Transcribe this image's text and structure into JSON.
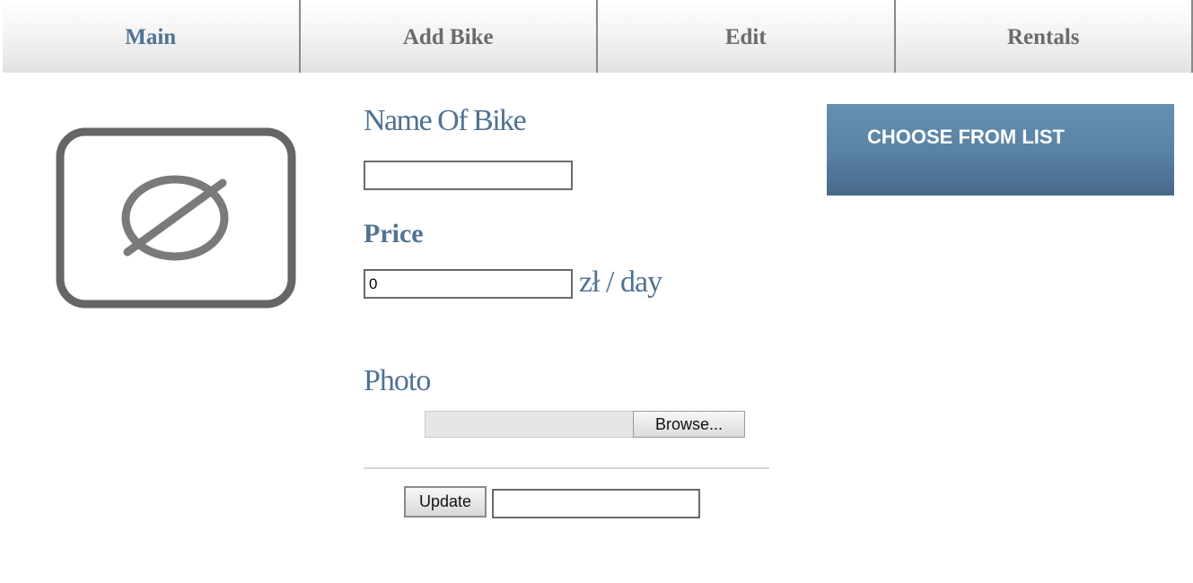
{
  "nav": {
    "tabs": [
      {
        "label": "Main",
        "active": true
      },
      {
        "label": "Add Bike",
        "active": false
      },
      {
        "label": "Edit",
        "active": false
      },
      {
        "label": "Rentals",
        "active": false
      }
    ]
  },
  "image": {
    "icon": "no-image-icon"
  },
  "form": {
    "name_label": "Name Of Bike",
    "name_value": "",
    "price_label": "Price",
    "price_value": "0",
    "price_unit": "zł / day",
    "photo_label": "Photo",
    "browse_label": "Browse...",
    "update_label": "Update",
    "update_field_value": ""
  },
  "side": {
    "choose_label": "CHOOSE FROM LIST"
  },
  "colors": {
    "accent": "#4f7394",
    "button_blue": "#5a83a4"
  }
}
